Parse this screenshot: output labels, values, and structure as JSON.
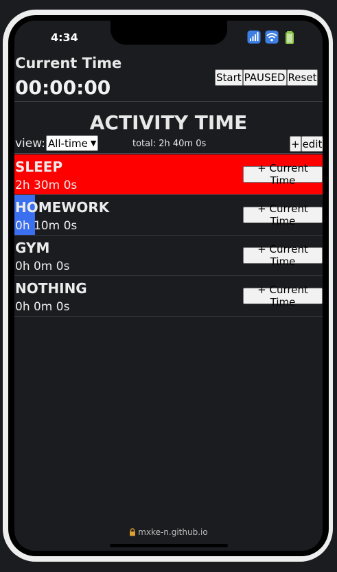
{
  "status_bar": {
    "time": "4:34"
  },
  "timer": {
    "label": "Current Time",
    "value": "00:00:00",
    "start_label": "Start",
    "paused_label": "PAUSED",
    "reset_label": "Reset"
  },
  "activity": {
    "title": "ACTIVITY TIME",
    "view_label": "view:",
    "view_selected": "All-time",
    "total": "total: 2h 40m 0s",
    "add_label": "+",
    "edit_label": "edit",
    "add_current_label": "+ Current Time",
    "items": [
      {
        "name": "SLEEP",
        "time": "2h 30m 0s",
        "color": "#ff0000",
        "progress": 1.0
      },
      {
        "name": "HOMEWORK",
        "time": "0h 10m 0s",
        "color": "#3a6ff0",
        "progress": 0.0667
      },
      {
        "name": "GYM",
        "time": "0h 0m 0s",
        "color": "#3a6ff0",
        "progress": 0
      },
      {
        "name": "NOTHING",
        "time": "0h 0m 0s",
        "color": "#3a6ff0",
        "progress": 0
      }
    ]
  },
  "browser": {
    "url": "mxke-n.github.io"
  }
}
